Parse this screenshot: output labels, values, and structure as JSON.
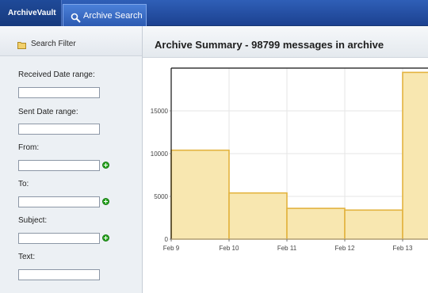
{
  "nav": {
    "brand": "ArchiveVault",
    "tab_label": "Archive Search",
    "tab_icon": "search-icon"
  },
  "sidebar": {
    "header": "Search Filter",
    "header_icon": "folder-icon",
    "fields": [
      {
        "label": "Received Date range:",
        "value": "",
        "add_button": false
      },
      {
        "label": "Sent Date range:",
        "value": "",
        "add_button": false
      },
      {
        "label": "From:",
        "value": "",
        "add_button": true
      },
      {
        "label": "To:",
        "value": "",
        "add_button": true
      },
      {
        "label": "Subject:",
        "value": "",
        "add_button": true
      },
      {
        "label": "Text:",
        "value": "",
        "add_button": false
      }
    ]
  },
  "main": {
    "title": "Archive Summary - 98799 messages in archive"
  },
  "colors": {
    "bar_fill": "#f8e7b0",
    "bar_stroke": "#e3b33f",
    "nav_blue": "#1f4a99"
  },
  "chart_data": {
    "type": "bar",
    "categories": [
      "Feb 9",
      "Feb 10",
      "Feb 11",
      "Feb 12",
      "Feb 13"
    ],
    "values": [
      10400,
      5400,
      3600,
      3400,
      19500
    ],
    "ylim": [
      0,
      20000
    ],
    "yticks": [
      0,
      5000,
      10000,
      15000
    ],
    "grid": true,
    "title": "",
    "xlabel": "",
    "ylabel": ""
  }
}
